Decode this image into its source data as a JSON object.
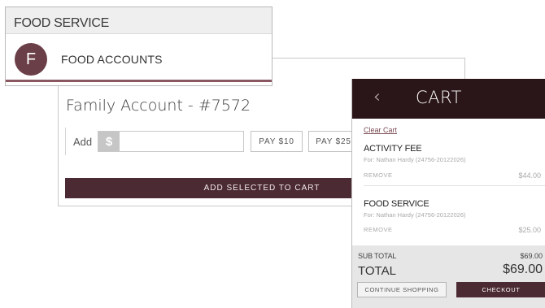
{
  "food_service": {
    "header": "FOOD SERVICE",
    "item": {
      "avatar_letter": "F",
      "label": "FOOD ACCOUNTS"
    }
  },
  "account": {
    "title": "Family Account - #7572",
    "add_label": "Add",
    "currency_symbol": "$",
    "amount_value": "",
    "pay_10_label": "PAY $10",
    "pay_25_label": "PAY $25",
    "add_to_cart_label": "ADD SELECTED TO CART"
  },
  "cart": {
    "back_glyph": "‹",
    "title": "CART",
    "clear_label": "Clear Cart",
    "items": [
      {
        "name": "ACTIVITY FEE",
        "for": "For: Nathan Hardy (24756-20122026)",
        "remove": "REMOVE",
        "price": "$44.00"
      },
      {
        "name": "FOOD SERVICE",
        "for": "For: Nathan Hardy (24756-20122026)",
        "remove": "REMOVE",
        "price": "$25.00"
      }
    ],
    "subtotal_label": "SUB TOTAL",
    "subtotal_value": "$69.00",
    "total_label": "TOTAL",
    "total_value": "$69.00",
    "continue_label": "CONTINUE SHOPPING",
    "checkout_label": "CHECKOUT"
  },
  "colors": {
    "brand_dark": "#2a1518",
    "brand": "#4b2a33",
    "avatar": "#6b3f47",
    "accent_line": "#8a5760"
  }
}
